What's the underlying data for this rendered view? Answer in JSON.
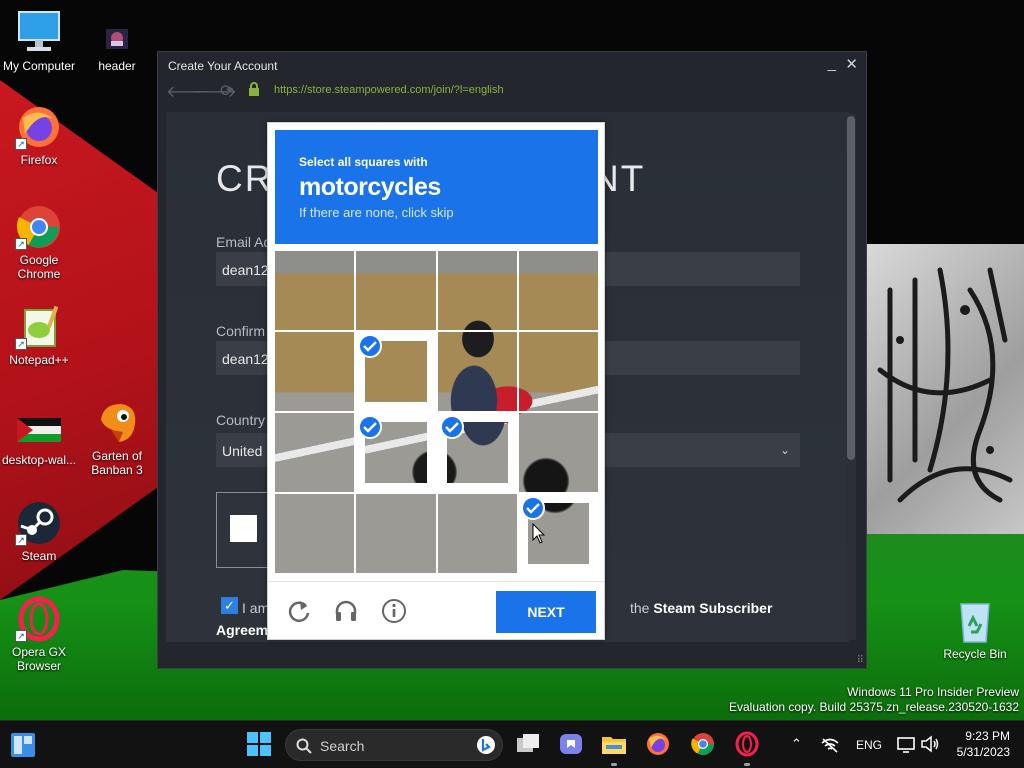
{
  "desktop": {
    "icons": [
      {
        "label": "My Computer",
        "icon": "computer-icon"
      },
      {
        "label": "header",
        "icon": "image-file-icon"
      },
      {
        "label": "Firefox",
        "icon": "firefox-icon"
      },
      {
        "label": "Google Chrome",
        "icon": "chrome-icon"
      },
      {
        "label": "Notepad++",
        "icon": "notepad-plus-plus-icon"
      },
      {
        "label": "desktop-wal...",
        "icon": "image-file-icon"
      },
      {
        "label": "Garten of Banban 3",
        "icon": "game-icon"
      },
      {
        "label": "Steam",
        "icon": "steam-icon"
      },
      {
        "label": "Opera GX Browser",
        "icon": "opera-gx-icon"
      },
      {
        "label": "Recycle Bin",
        "icon": "recycle-bin-icon"
      }
    ]
  },
  "steam_window": {
    "title": "Create Your Account",
    "url": "https://store.steampowered.com/join/?l=english",
    "heading_left": "CRE",
    "heading_right": "NT",
    "email_label": "Email Ad",
    "email_value": "dean12",
    "confirm_label": "Confirm",
    "confirm_value": "dean12",
    "country_label": "Country",
    "country_value": "United",
    "agree_prefix": "I am",
    "agree_suffix": "the",
    "agree_bold": "Steam Subscriber",
    "agree_bold2": "Agreem"
  },
  "captcha": {
    "instruction_small": "Select all squares with",
    "instruction_target": "motorcycles",
    "instruction_hint": "If there are none, click skip",
    "next_label": "NEXT",
    "selected_tiles": [
      5,
      9,
      10,
      15
    ],
    "colors": {
      "accent": "#1a73e8"
    }
  },
  "watermark": {
    "line1": "Windows 11 Pro Insider Preview",
    "line2": "Evaluation copy. Build 25375.zn_release.230520-1632"
  },
  "taskbar": {
    "search_label": "Search",
    "language": "ENG",
    "time": "9:23 PM",
    "date": "5/31/2023"
  }
}
